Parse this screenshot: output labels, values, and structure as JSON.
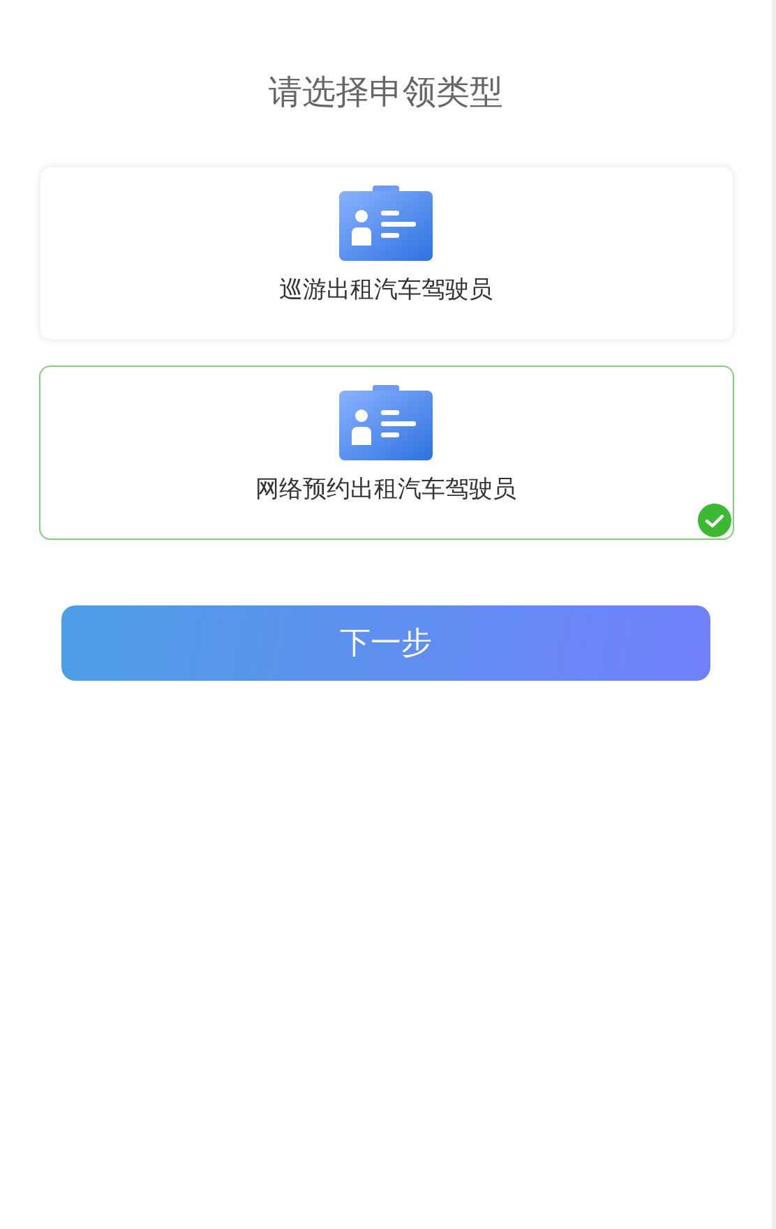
{
  "title": "请选择申领类型",
  "options": [
    {
      "label": "巡游出租汽车驾驶员",
      "selected": false
    },
    {
      "label": "网络预约出租汽车驾驶员",
      "selected": true
    }
  ],
  "next_button": "下一步"
}
